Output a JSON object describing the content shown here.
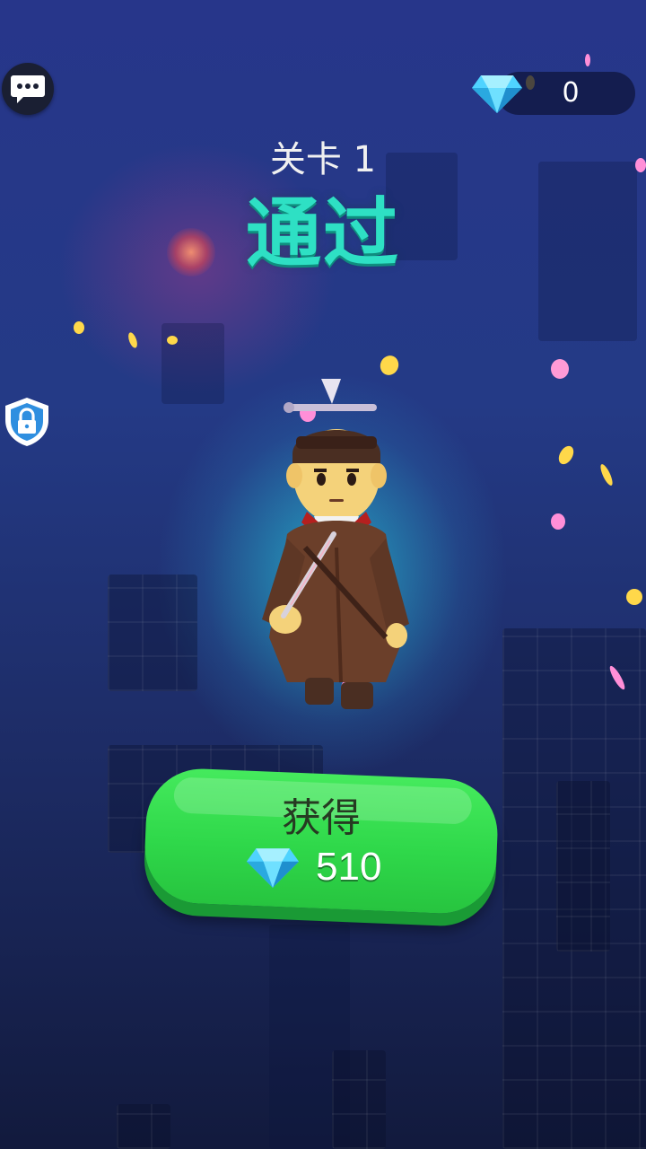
{
  "hud": {
    "gem_count": "0",
    "gem_icon": "diamond-icon",
    "chat_icon": "chat-bubble-icon",
    "lock_icon": "shield-lock-icon"
  },
  "result": {
    "level_label": "关卡 1",
    "status": "通过"
  },
  "reward_button": {
    "label": "获得",
    "amount": "510",
    "icon": "diamond-icon"
  },
  "colors": {
    "title_teal": "#2ee0c4",
    "button_green": "#33d84c",
    "gem_blue": "#4fd3ff",
    "petal_pink": "#ff8fd8",
    "petal_gold": "#ffd84a"
  }
}
